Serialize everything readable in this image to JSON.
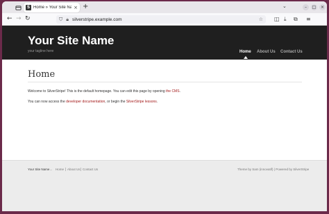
{
  "browser": {
    "tab_title": "Home » Your Site Name",
    "tab_favicon": "S",
    "new_tab": "+",
    "tab_close": "×",
    "url_prefix": "",
    "url_host": "silverstripe.example.com"
  },
  "site": {
    "name": "Your Site Name",
    "tagline": "your tagline here",
    "menu": [
      "Home",
      "About Us",
      "Contact Us"
    ]
  },
  "page": {
    "title": "Home",
    "p1_before": "Welcome to SilverStripe! This is the default homepage. You can edit this page by opening ",
    "p1_link": "the CMS",
    "p1_after": ".",
    "p2_before": "You can now access the ",
    "p2_link1": "developer documentation",
    "p2_mid": ", or begin the ",
    "p2_link2": "SilverStripe lessons",
    "p2_after": "."
  },
  "footer": {
    "site_name": "Your Site Name",
    "arrow": "→",
    "links": [
      "Home",
      "About Us",
      "Contact Us"
    ],
    "credit": "Theme by Sam (innovatif) | Powered by SilverStripe"
  },
  "colors": {
    "desktop": "#6b2a4a",
    "header": "#1f1f1f",
    "link": "#a31818",
    "footer": "#ececec"
  }
}
